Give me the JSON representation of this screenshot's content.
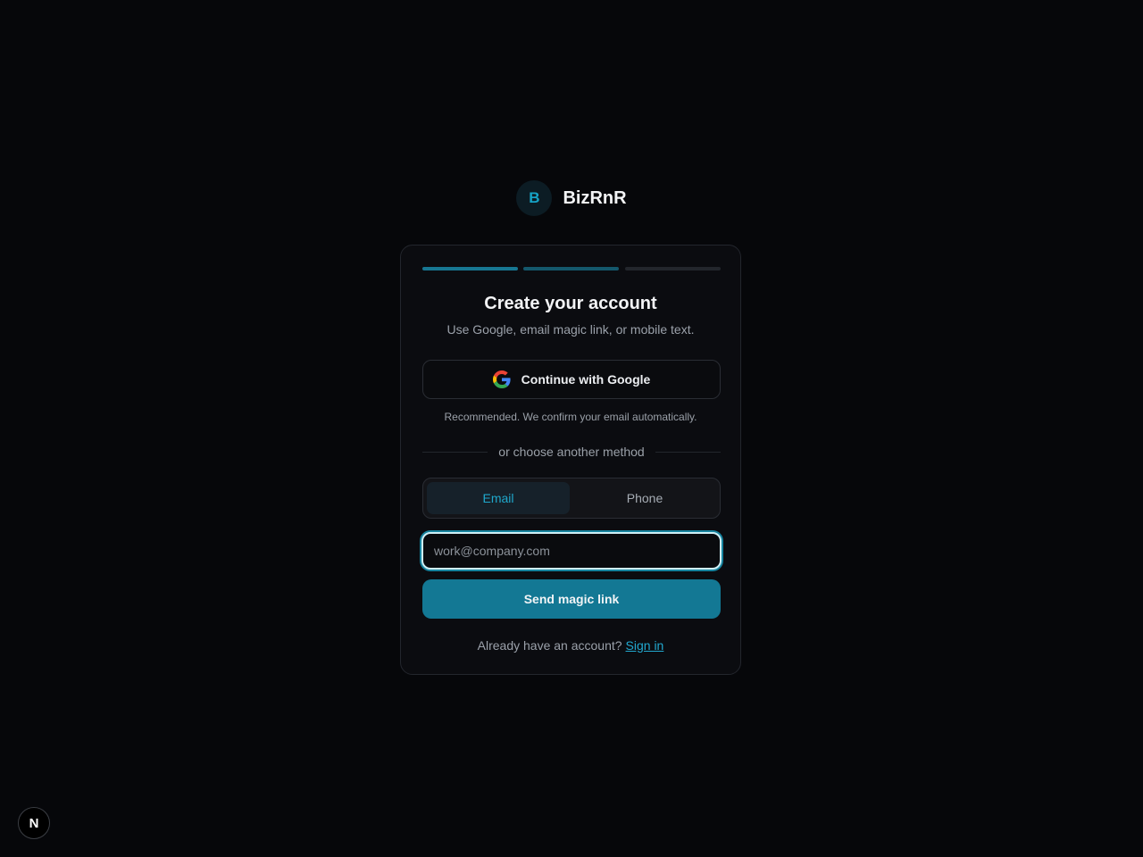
{
  "brand": {
    "logo_letter": "B",
    "name": "BizRnR"
  },
  "progress": {
    "steps": 3,
    "current": 2
  },
  "card": {
    "title": "Create your account",
    "subtitle": "Use Google, email magic link, or mobile text.",
    "google_button_label": "Continue with Google",
    "google_hint": "Recommended. We confirm your email automatically.",
    "divider_text": "or choose another method",
    "tabs": [
      {
        "label": "Email",
        "active": true
      },
      {
        "label": "Phone",
        "active": false
      }
    ],
    "email_input": {
      "value": "",
      "placeholder": "work@company.com"
    },
    "send_button_label": "Send magic link",
    "footer_text": "Already have an account?",
    "footer_link": "Sign in"
  },
  "dev_badge": {
    "label": "N",
    "icon": "nextjs-logo-icon"
  },
  "colors": {
    "background": "#06070a",
    "card": "#0b0c10",
    "accent": "#137894",
    "link": "#22a8cf"
  }
}
